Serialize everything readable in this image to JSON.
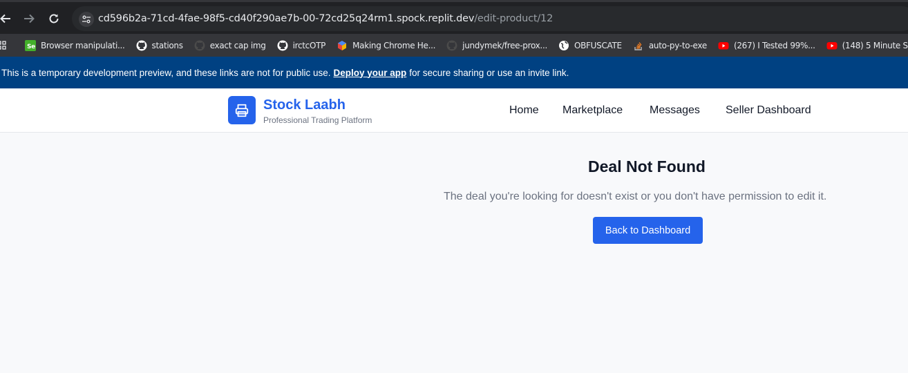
{
  "browser": {
    "url_host": "cd596b2a-71cd-4fae-98f5-cd40f290ae7b-00-72cd25q24rm1.spock.replit.dev",
    "url_path": "/edit-product/12",
    "bookmarks": [
      {
        "label": "Browser manipulati...",
        "icon": "selenium-icon",
        "color": "#43b02a"
      },
      {
        "label": "stations",
        "icon": "github-icon",
        "color": "#ffffff"
      },
      {
        "label": "exact cap img",
        "icon": "github-icon",
        "color": "#4b4b4b"
      },
      {
        "label": "irctcOTP",
        "icon": "github-icon",
        "color": "#ffffff"
      },
      {
        "label": "Making Chrome He...",
        "icon": "chrome-ext-icon",
        "color": "#e8453c"
      },
      {
        "label": "jundymek/free-prox...",
        "icon": "github-icon",
        "color": "#4b4b4b"
      },
      {
        "label": "OBFUSCATE",
        "icon": "globe-icon",
        "color": "#ffffff"
      },
      {
        "label": "auto-py-to-exe",
        "icon": "stackoverflow-icon",
        "color": "#f48024"
      },
      {
        "label": "(267) I Tested 99%...",
        "icon": "youtube-icon",
        "color": "#ff0000"
      },
      {
        "label": "(148) 5 Minute Scal...",
        "icon": "youtube-icon",
        "color": "#ff0000"
      }
    ]
  },
  "banner": {
    "text_before": "This is a temporary development preview, and these links are not for public use.",
    "link": "Deploy your app",
    "text_after": "for secure sharing or use an invite link."
  },
  "header": {
    "brand": "Stock Laabh",
    "tagline": "Professional Trading Platform",
    "nav": [
      "Home",
      "Marketplace",
      "Messages",
      "Seller Dashboard"
    ]
  },
  "main": {
    "title": "Deal Not Found",
    "message": "The deal you're looking for doesn't exist or you don't have permission to edit it.",
    "button": "Back to Dashboard"
  },
  "colors": {
    "primary": "#2563eb",
    "banner_bg": "#004182",
    "page_bg": "#f8f9fb"
  }
}
